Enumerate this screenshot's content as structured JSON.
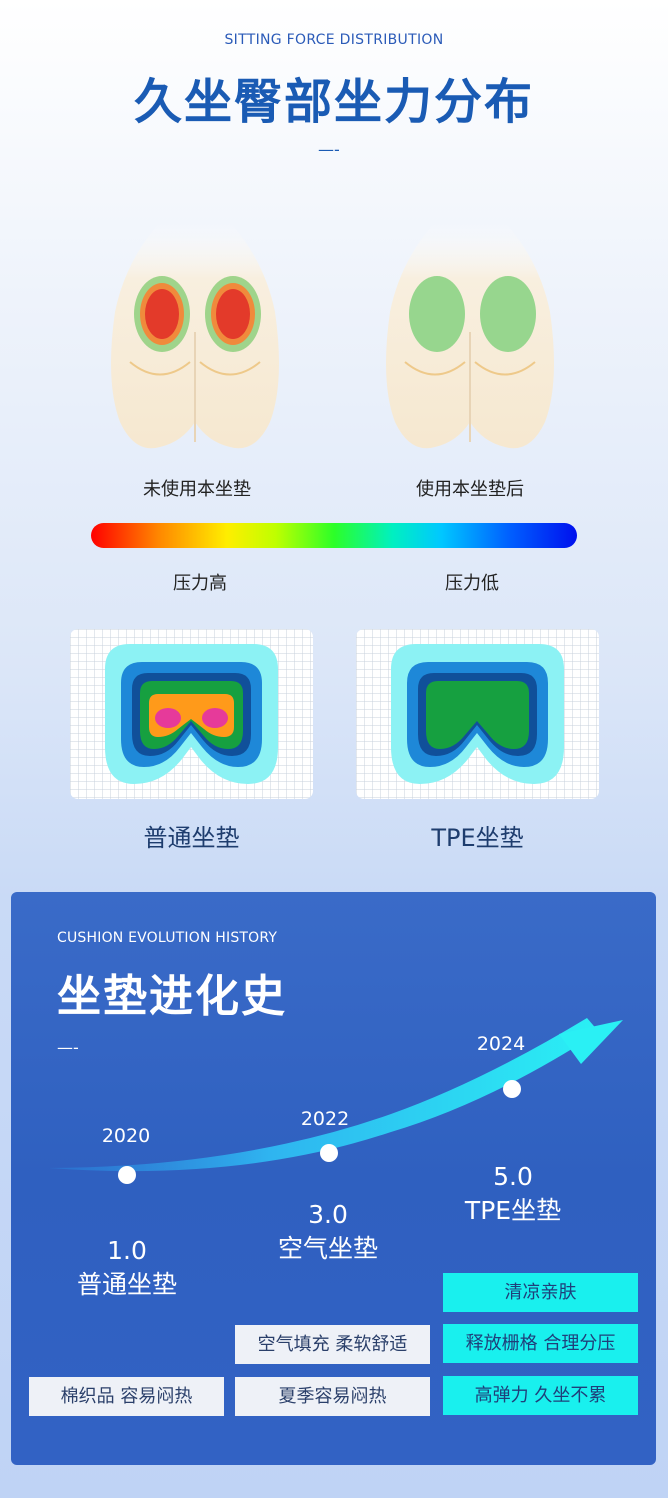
{
  "header": {
    "en_title": "SITTING FORCE DISTRIBUTION",
    "cn_title": "久坐臀部坐力分布",
    "dash": "—-"
  },
  "comparison": {
    "before_label": "未使用本坐垫",
    "after_label": "使用本坐垫后"
  },
  "pressure_scale": {
    "high_label": "压力高",
    "low_label": "压力低"
  },
  "maps": {
    "normal_label": "普通坐垫",
    "tpe_label": "TPE坐垫"
  },
  "evolution": {
    "en_title": "CUSHION EVOLUTION HISTORY",
    "cn_title": "坐垫进化史",
    "dash": "—-",
    "milestones": [
      {
        "year": "2020",
        "version": "1.0",
        "name": "普通坐垫"
      },
      {
        "year": "2022",
        "version": "3.0",
        "name": "空气坐垫"
      },
      {
        "year": "2024",
        "version": "5.0",
        "name": "TPE坐垫"
      }
    ],
    "tags": {
      "v1": [
        "棉织品 容易闷热"
      ],
      "v3": [
        "空气填充 柔软舒适",
        "夏季容易闷热"
      ],
      "v5": [
        "清凉亲肤",
        "释放栅格 合理分压",
        "高弹力 久坐不累"
      ]
    }
  },
  "colors": {
    "title_blue": "#1a5bb4",
    "panel_blue": "#3262c4",
    "tag_cyan": "#19f0ee",
    "tag_gray": "#eef1f7"
  }
}
